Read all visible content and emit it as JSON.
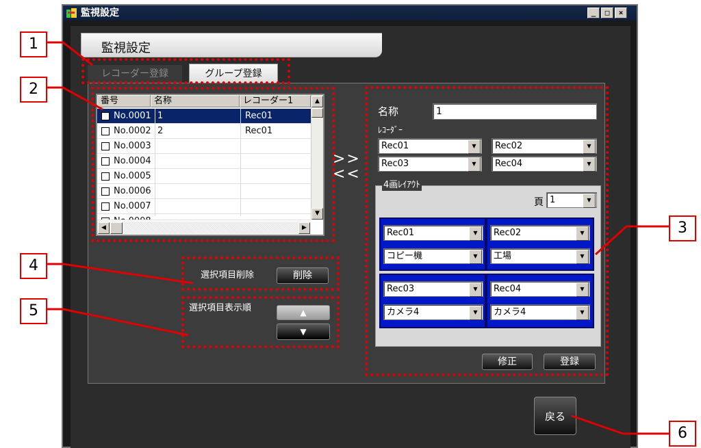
{
  "window": {
    "title": "監視設定",
    "buttons": [
      "_",
      "□",
      "×"
    ]
  },
  "header": {
    "title": "監視設定"
  },
  "tabs": [
    {
      "label": "レコーダー登録",
      "active": false
    },
    {
      "label": "グループ登録",
      "active": true
    }
  ],
  "list": {
    "headers": [
      "番号",
      "名称",
      "レコーダー1"
    ],
    "rows": [
      {
        "no": "No.0001",
        "name": "1",
        "recorder": "Rec01",
        "selected": true
      },
      {
        "no": "No.0002",
        "name": "2",
        "recorder": "Rec01",
        "selected": false
      },
      {
        "no": "No.0003",
        "name": "",
        "recorder": "",
        "selected": false
      },
      {
        "no": "No.0004",
        "name": "",
        "recorder": "",
        "selected": false
      },
      {
        "no": "No.0005",
        "name": "",
        "recorder": "",
        "selected": false
      },
      {
        "no": "No.0006",
        "name": "",
        "recorder": "",
        "selected": false
      },
      {
        "no": "No.0007",
        "name": "",
        "recorder": "",
        "selected": false
      },
      {
        "no": "No.0008",
        "name": "",
        "recorder": "",
        "selected": false
      }
    ]
  },
  "transfer": {
    "right": ">>",
    "left": "<<"
  },
  "form": {
    "name_label": "名称",
    "name_value": "1",
    "recorder_label": "ﾚｺｰﾀﾞｰ",
    "recorders": [
      "Rec01",
      "Rec02",
      "Rec03",
      "Rec04"
    ],
    "layout_label": "4画ﾚｲｱｳﾄ",
    "page_label": "頁",
    "page_value": "1",
    "cells": [
      {
        "recorder": "Rec01",
        "camera": "コピー機"
      },
      {
        "recorder": "Rec02",
        "camera": "工場"
      },
      {
        "recorder": "Rec03",
        "camera": "カメラ4"
      },
      {
        "recorder": "Rec04",
        "camera": "カメラ4"
      }
    ],
    "modify_button": "修正",
    "register_button": "登録"
  },
  "delete": {
    "label": "選択項目削除",
    "button": "削除"
  },
  "order": {
    "label": "選択項目表示順",
    "up": "▲",
    "down": "▼"
  },
  "back_button": "戻る",
  "callouts": [
    "1",
    "2",
    "3",
    "4",
    "5",
    "6"
  ],
  "colors": {
    "annotation_red": "#e00000",
    "selection": "#0a246a",
    "layout_blue": "#0018c8"
  }
}
